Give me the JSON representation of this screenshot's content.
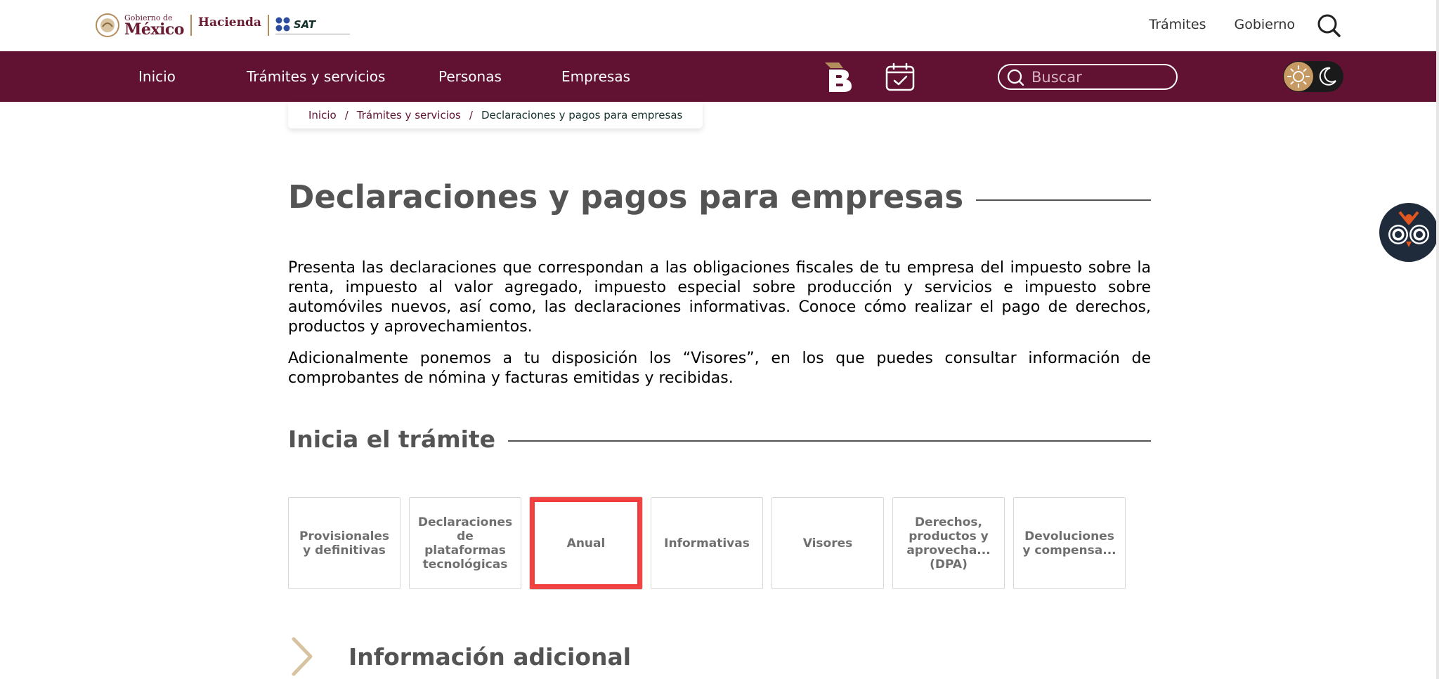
{
  "header": {
    "gobierno_small": "Gobierno de",
    "gobierno_big": "México",
    "hacienda": "Hacienda",
    "sat": "SAT",
    "links": [
      "Trámites",
      "Gobierno"
    ]
  },
  "nav": {
    "items": [
      "Inicio",
      "Trámites y servicios",
      "Personas",
      "Empresas"
    ],
    "search_placeholder": "Buscar",
    "icons": [
      "b-logo-icon",
      "calendar-check-icon",
      "search-icon",
      "sun-icon",
      "moon-icon"
    ]
  },
  "breadcrumb": {
    "items": [
      "Inicio",
      "Trámites y servicios"
    ],
    "current": "Declaraciones y pagos para empresas",
    "separator": "/"
  },
  "main": {
    "title": "Declaraciones y pagos para empresas",
    "intro_1": "Presenta las declaraciones que correspondan a las obligaciones fiscales de tu empresa del impuesto sobre la renta, impuesto al valor agregado, impuesto especial sobre producción y servicios e impuesto sobre automóviles nuevos, así como, las declaraciones informativas. Conoce cómo realizar el pago de derechos, productos y aprovechamientos.",
    "intro_2": "Adicionalmente ponemos a tu disposición los “Visores”, en los que puedes consultar información de comprobantes de nómina y facturas emitidas y recibidas.",
    "section_title": "Inicia el trámite",
    "cards": [
      "Provisionales y definitivas",
      "Declaraciones de plataformas tecnológicas",
      "Anual",
      "Informativas",
      "Visores",
      "Derechos, productos y aprovecha... (DPA)",
      "Devoluciones y compensa..."
    ],
    "selected_card": "Anual",
    "info_title": "Información adicional"
  },
  "colors": {
    "brand": "#611232",
    "gold": "#b38e5d",
    "highlight": "#f04545",
    "text_gray": "#545454"
  }
}
